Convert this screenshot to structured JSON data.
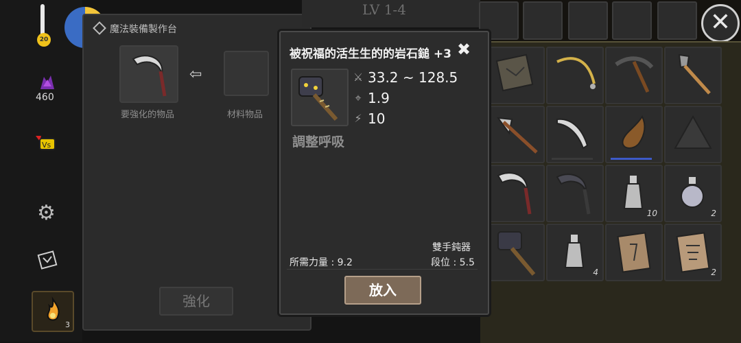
{
  "hud": {
    "temperature": "20",
    "purple_count": "460",
    "fire_count": "3",
    "level_text": "LV 1-4"
  },
  "craft_panel": {
    "title": "魔法裝備製作台",
    "item_slot_label": "要強化的物品",
    "material_slot_label": "材料物品",
    "strengthen_button": "強化"
  },
  "dialog": {
    "title": "被祝福的活生生的的岩石鎚 +3",
    "damage": "33.2 ~ 128.5",
    "accuracy": "1.9",
    "speed": "10",
    "skill": "調整呼吸",
    "strength_req": "所需力量 : 9.2",
    "weapon_type": "雙手鈍器",
    "tier": "段位 : 5.5",
    "put_in_button": "放入"
  },
  "inventory": {
    "counts": [
      "10",
      "2",
      "4",
      "2"
    ]
  },
  "colors": {
    "panel": "#2b2b2b",
    "dialog": "#2c2c2c",
    "button_brown": "#7d6a58",
    "inventory_bg": "#2a281c"
  }
}
